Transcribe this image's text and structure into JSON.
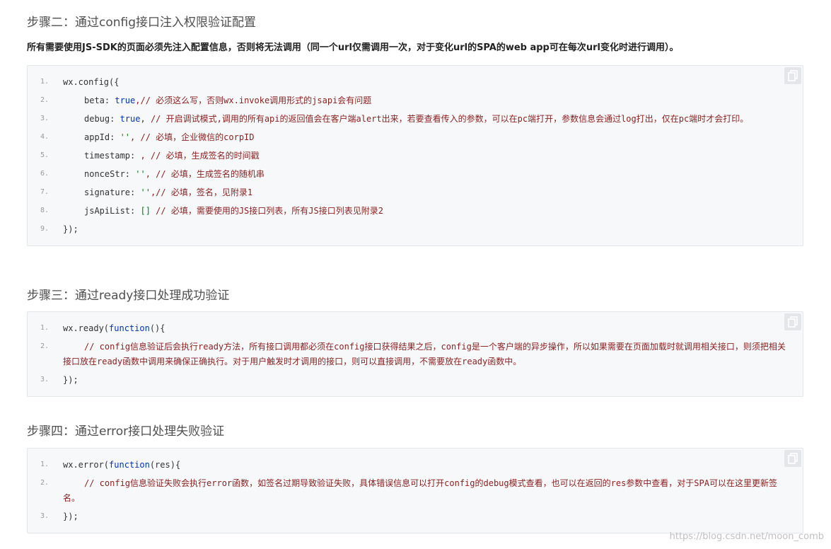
{
  "step2": {
    "heading": "步骤二：通过config接口注入权限验证配置",
    "lead": "所有需要使用JS-SDK的页面必须先注入配置信息，否则将无法调用（同一个url仅需调用一次，对于变化url的SPA的web app可在每次url变化时进行调用）。",
    "ln": [
      "1.",
      "2.",
      "3.",
      "4.",
      "5.",
      "6.",
      "7.",
      "8.",
      "9."
    ],
    "l1": "wx.config({",
    "l2_key": "beta: ",
    "l2_val": "true",
    "l2_cm": ",// 必须这么写，否则wx.invoke调用形式的jsapi会有问题",
    "l3_key": "debug: ",
    "l3_val": "true",
    "l3_sep": ", ",
    "l3_cm": "// 开启调试模式,调用的所有api的返回值会在客户端alert出来，若要查看传入的参数，可以在pc端打开，参数信息会通过log打出，仅在pc端时才会打印。",
    "l4_key": "appId: ",
    "l4_val": "''",
    "l4_cm": ", // 必填，企业微信的corpID",
    "l5_key": "timestamp: ",
    "l5_cm": ", // 必填，生成签名的时间戳",
    "l6_key": "nonceStr: ",
    "l6_val": "''",
    "l6_cm": ", // 必填，生成签名的随机串",
    "l7_key": "signature: ",
    "l7_val": "''",
    "l7_cm": ",// 必填，签名，见附录1",
    "l8_key": "jsApiList: ",
    "l8_val": "[]",
    "l8_cm": " // 必填，需要使用的JS接口列表，所有JS接口列表见附录2",
    "l9": "});"
  },
  "step3": {
    "heading": "步骤三：通过ready接口处理成功验证",
    "ln": [
      "1.",
      "2.",
      "3."
    ],
    "l1_pre": "wx.ready(",
    "l1_kw": "function",
    "l1_post": "(){",
    "l2_cm": "// config信息验证后会执行ready方法，所有接口调用都必须在config接口获得结果之后，config是一个客户端的异步操作，所以如果需要在页面加载时就调用相关接口，则须把相关接口放在ready函数中调用来确保正确执行。对于用户触发时才调用的接口，则可以直接调用，不需要放在ready函数中。",
    "l3": "});"
  },
  "step4": {
    "heading": "步骤四：通过error接口处理失败验证",
    "ln": [
      "1.",
      "2.",
      "3."
    ],
    "l1_pre": "wx.error(",
    "l1_kw": "function",
    "l1_post": "(res){",
    "l2_cm": "// config信息验证失败会执行error函数，如签名过期导致验证失败，具体错误信息可以打开config的debug模式查看，也可以在返回的res参数中查看，对于SPA可以在这里更新签名。",
    "l3": "});"
  },
  "watermark": "https://blog.csdn.net/moon_comb",
  "icons": {
    "copy": "copy-icon"
  },
  "colors": {
    "keyword": "#0033b3",
    "string": "#067d17",
    "comment": "#8b1e1e",
    "code_bg": "#f6f8fa"
  }
}
